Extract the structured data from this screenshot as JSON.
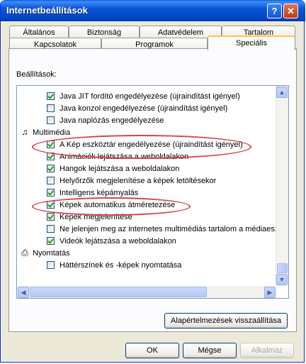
{
  "window": {
    "title": "Internetbeállítások",
    "help": "?",
    "close": "✕"
  },
  "tabs_back": [
    {
      "label": "Általános"
    },
    {
      "label": "Biztonság"
    },
    {
      "label": "Adatvédelem"
    },
    {
      "label": "Tartalom"
    }
  ],
  "tabs_front": [
    {
      "label": "Kapcsolatok"
    },
    {
      "label": "Programok"
    },
    {
      "label": "Speciális",
      "active": true
    }
  ],
  "settings_label": "Beállítások:",
  "settings_rows": [
    {
      "type": "check",
      "checked": true,
      "label": "Java JIT fordító engedélyezése (újraindítást igényel)"
    },
    {
      "type": "check",
      "checked": false,
      "label": "Java konzol engedélyezése (újraindítást igényel)"
    },
    {
      "type": "check",
      "checked": false,
      "label": "Java naplózás engedélyezése"
    },
    {
      "type": "category",
      "icon": "multimedia-icon",
      "label": "Multimédia"
    },
    {
      "type": "check",
      "checked": true,
      "label": "A Kép eszköztár engedélyezése (újraindítást igényel)"
    },
    {
      "type": "check",
      "checked": true,
      "label": "Animációk lejátszása a weboldalakon"
    },
    {
      "type": "check",
      "checked": true,
      "label": "Hangok lejátszása a weboldalakon"
    },
    {
      "type": "check",
      "checked": false,
      "label": "Helyőrzők megjelenítése a képek letöltésekor"
    },
    {
      "type": "check",
      "checked": true,
      "label": "Intelligens képámyalás"
    },
    {
      "type": "check",
      "checked": true,
      "label": "Képek automatikus átméretezése"
    },
    {
      "type": "check",
      "checked": true,
      "label": "Képek megjelenítése"
    },
    {
      "type": "check",
      "checked": false,
      "label": "Ne jelenjen meg az internetes multimédiás tartalom a médiaeszl"
    },
    {
      "type": "check",
      "checked": true,
      "label": "Videók lejátszása a weboldalakon"
    },
    {
      "type": "category",
      "icon": "printer-icon",
      "label": "Nyomtatás"
    },
    {
      "type": "check",
      "checked": false,
      "label": "Háttérszínek és -képek nyomtatása"
    }
  ],
  "restore_defaults": "Alapértelmezések visszaállítása",
  "buttons": {
    "ok": "OK",
    "cancel": "Mégse",
    "apply": "Alkalmaz"
  },
  "accent": {
    "annotation": "#d8404a",
    "title_bar": "#0a55d6"
  }
}
